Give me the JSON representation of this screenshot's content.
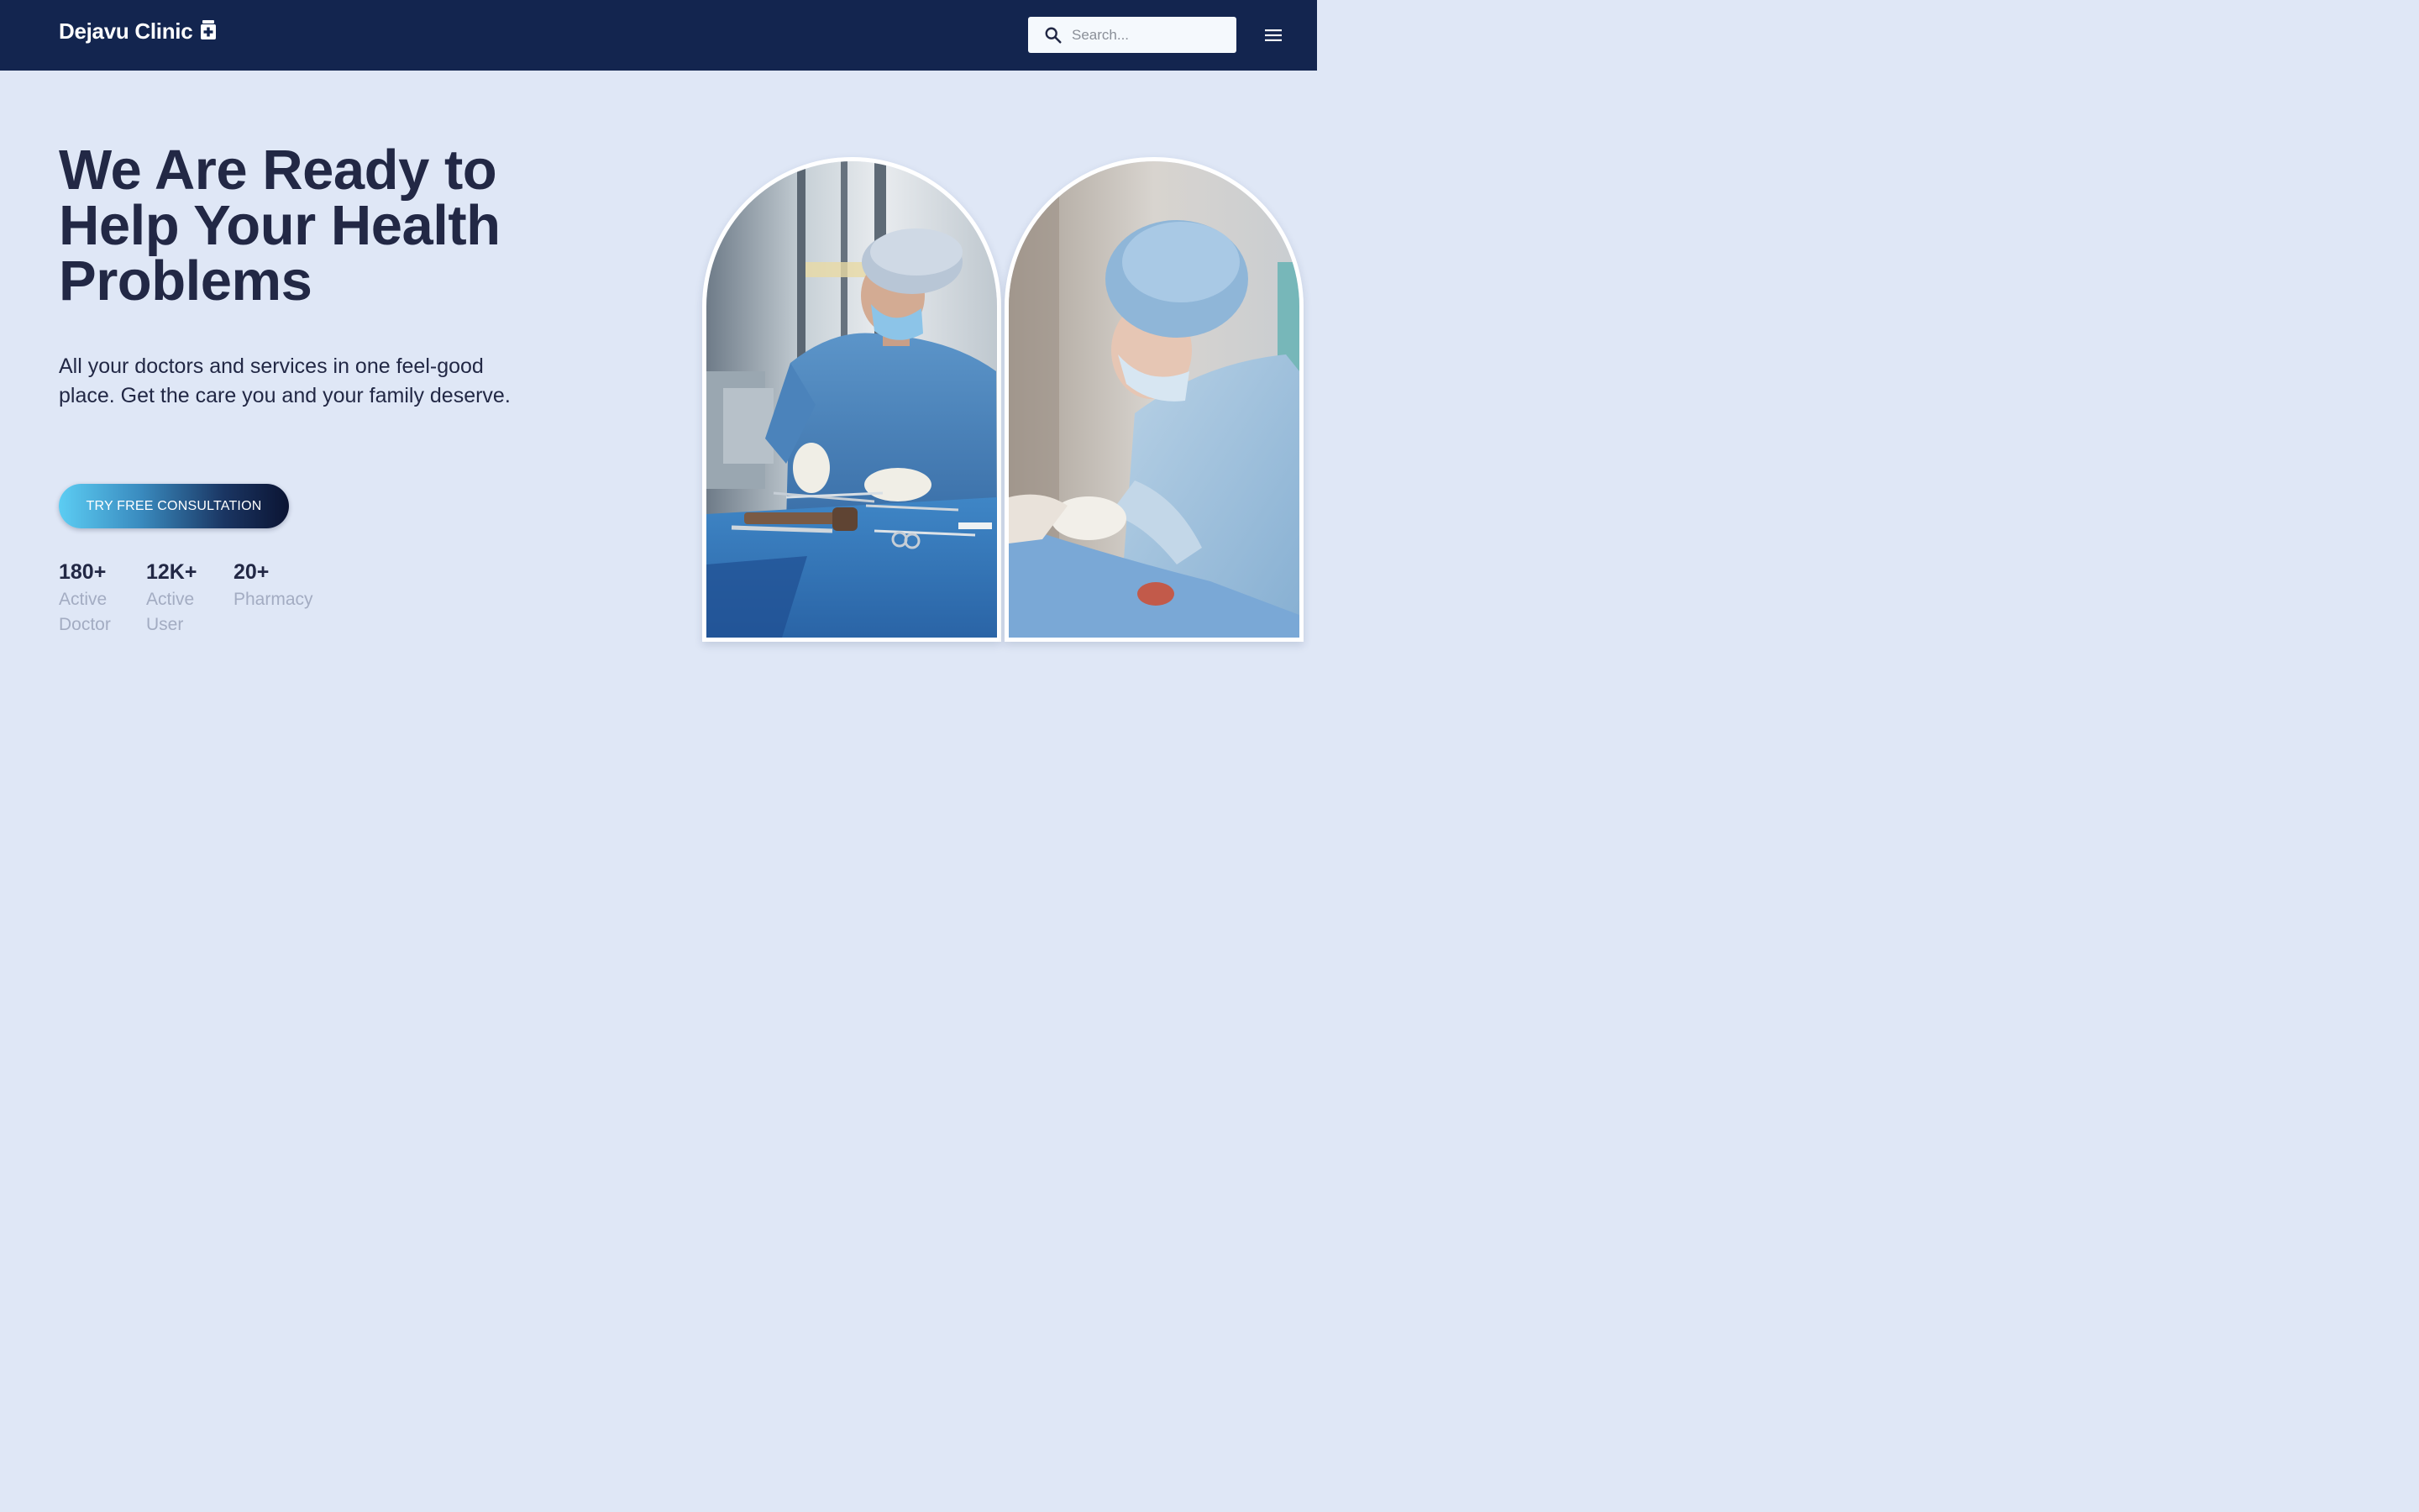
{
  "navbar": {
    "brand": "Dejavu Clinic",
    "search_placeholder": "Search..."
  },
  "hero": {
    "headline": "We Are Ready to Help Your Health Problems",
    "subtext": "All your doctors and services in one feel-good place. Get the care you and your family deserve.",
    "cta_label": "TRY FREE CONSULTATION",
    "stats": [
      {
        "value": "180+",
        "label": "Active Doctor"
      },
      {
        "value": "12K+",
        "label": "Active User"
      },
      {
        "value": "20+",
        "label": "Pharmacy"
      }
    ]
  },
  "colors": {
    "navbar_bg": "#13254f",
    "page_bg": "#dfe7f6",
    "text_dark": "#222845",
    "text_muted": "#a3acc2"
  },
  "icons": {
    "brand": "medical-kit-icon",
    "search": "search-icon",
    "menu": "hamburger-menu-icon"
  }
}
